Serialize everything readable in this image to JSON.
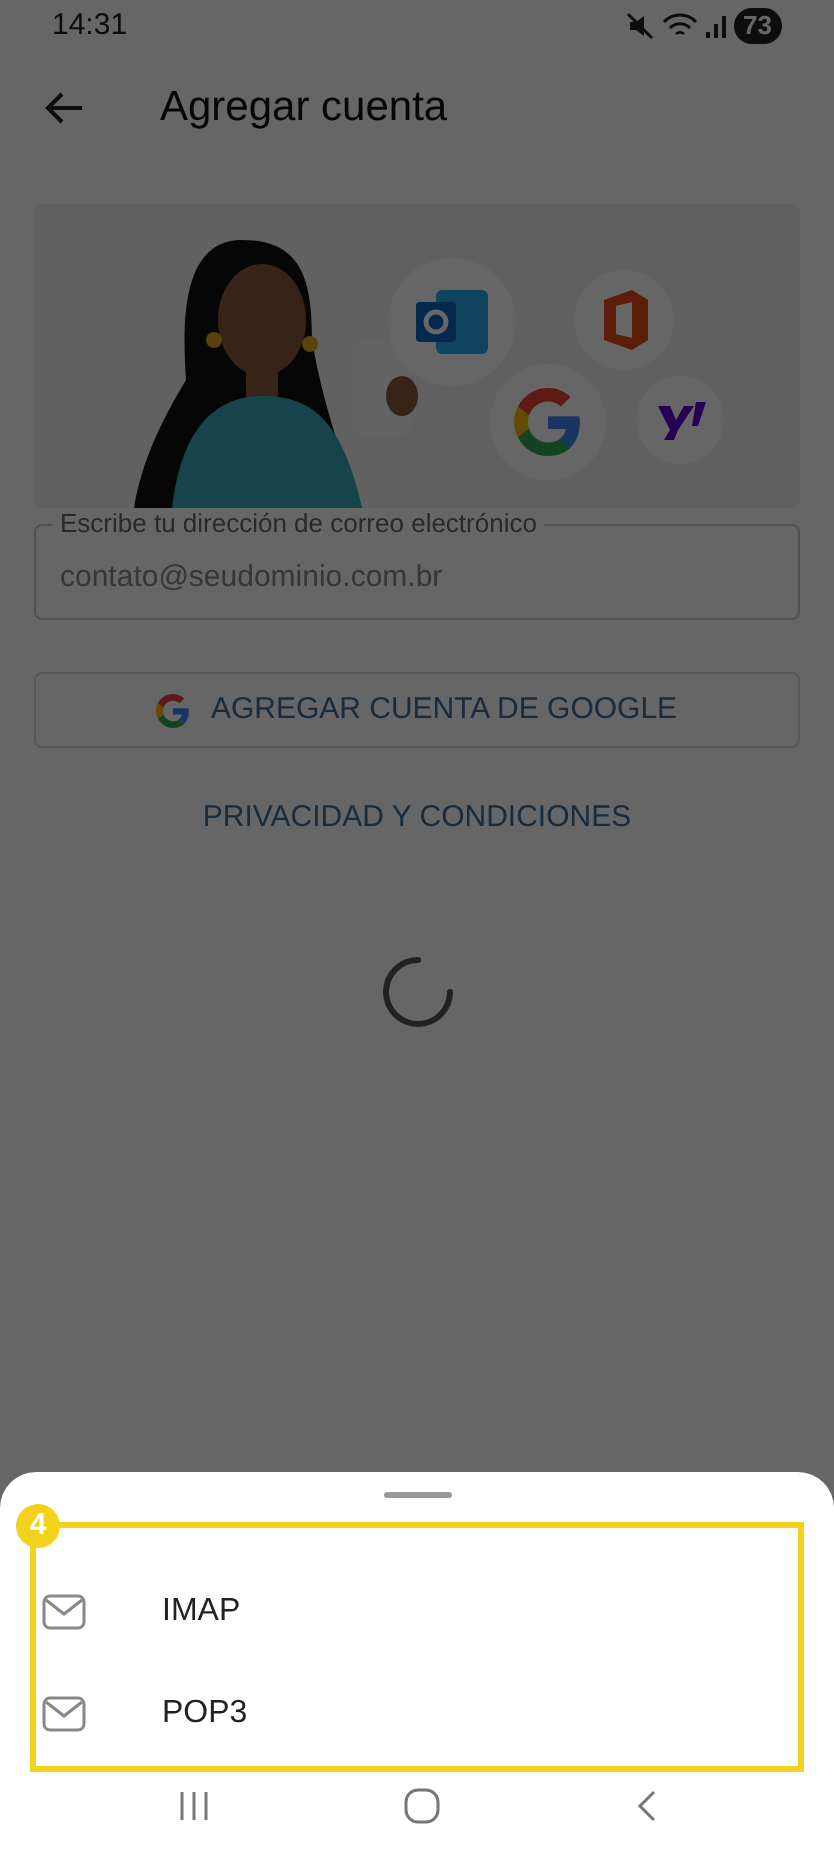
{
  "status_bar": {
    "time": "14:31",
    "battery": "73"
  },
  "header": {
    "title": "Agregar cuenta"
  },
  "email_field": {
    "label": "Escribe tu dirección de correo electrónico",
    "placeholder": "contato@seudominio.com.br"
  },
  "google_button": {
    "label": "AGREGAR CUENTA DE GOOGLE"
  },
  "privacy_link": {
    "label": "PRIVACIDAD Y CONDICIONES"
  },
  "sheet": {
    "badge": "4",
    "options": [
      {
        "label": "IMAP"
      },
      {
        "label": "POP3"
      }
    ]
  }
}
